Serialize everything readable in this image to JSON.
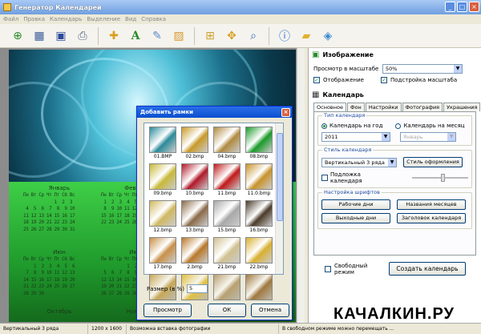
{
  "window": {
    "title": "Генератор Календарей"
  },
  "menu": [
    "Файл",
    "Правка",
    "Календарь",
    "Выделение",
    "Вид",
    "Справка"
  ],
  "toolbar": {
    "buttons": [
      "add-image",
      "calendar",
      "save",
      "print",
      "add-frame",
      "add-text",
      "edit",
      "picture",
      "grid",
      "move",
      "zoom",
      "help",
      "folder",
      "box"
    ]
  },
  "calendar_preview": {
    "months": [
      {
        "name": "Январь",
        "header": "Пн Вт Ср Чт Пт Сб Вс",
        "days": "            1  2  3\n 4  5  6  7  8  9 10\n11 12 13 14 15 16 17\n18 19 20 21 22 23 24\n25 26 27 28 29 30 31"
      },
      {
        "name": "Февраль",
        "header": "Пн Вт Ср Чт Пт Сб Вс",
        "days": " 1  2  3  4  5  6  7\n 8  9 10 11 12 13 14\n15 16 17 18 19 20 21\n22 23 24 25 26 27 28"
      },
      {
        "name": "Июн",
        "header": "Пн Вт Ср Чт Пт Сб Вс",
        "days": "    1  2  3  4  5  6\n 7  8  9 10 11 12 13\n14 15 16 17 18 19 20\n21 22 23 24 25 26 27\n28 29 30"
      },
      {
        "name": "Июль",
        "header": "Пн Вт Ср Чт Пт Сб Вс",
        "days": "          1  2  3  4\n 5  6  7  8  9 10 11\n12 13 14 15 16 17 18\n19 20 21 22 23 24 25\n26 27 28 29 30 31"
      },
      {
        "name": "Октябрь",
        "header": "",
        "days": ""
      },
      {
        "name": "Ноябрь",
        "header": "",
        "days": ""
      }
    ]
  },
  "image_panel": {
    "header": "Изображение",
    "zoom_label": "Просмотр в масштабе",
    "zoom_value": "50%",
    "stretch_label": "Отображение",
    "fit_label": "Подстройка масштаба"
  },
  "calendar_panel": {
    "header": "Календарь",
    "tabs": [
      "Основное",
      "Фон",
      "Настройки",
      "Фотография",
      "Украшения"
    ],
    "type_group": "Тип календаря",
    "radio_year": "Календарь на год",
    "radio_month": "Календарь на месяц",
    "year_value": "2011",
    "month_value": "Январь",
    "style_group": "Стиль календаря",
    "style_value": "Вертикальный 3 ряда",
    "style_button": "Стиль оформления",
    "shadow_label": "Подложка календаря",
    "fonts_group": "Настройка шрифтов",
    "btn_workdays": "Рабочие дни",
    "btn_monthnames": "Названия месяцев",
    "btn_weekends": "Выходные дни",
    "btn_title": "Заголовок календаря",
    "free_mode_label": "Свободный режим",
    "create_button": "Создать календарь"
  },
  "dialog": {
    "title": "Добавить рамки",
    "tiles": [
      {
        "label": "01.BMP",
        "color": "#2a8a9a"
      },
      {
        "label": "02.bmp",
        "color": "#c89a28"
      },
      {
        "label": "04.bmp",
        "color": "#b08a40"
      },
      {
        "label": "08.bmp",
        "color": "#1a9a2a"
      },
      {
        "label": "09.bmp",
        "color": "#c8b838"
      },
      {
        "label": "10.bmp",
        "color": "#b01828"
      },
      {
        "label": "11.bmp",
        "color": "#c01818"
      },
      {
        "label": "11.0.bmp",
        "color": "#c8922a"
      },
      {
        "label": "12.bmp",
        "color": "#d0b860"
      },
      {
        "label": "13.bmp",
        "color": "#8a6a48"
      },
      {
        "label": "15.bmp",
        "color": "#a8a8a8"
      },
      {
        "label": "16.bmp",
        "color": "#4a3a28"
      },
      {
        "label": "17.bmp",
        "color": "#c89048"
      },
      {
        "label": "2.bmp",
        "color": "#b8782a"
      },
      {
        "label": "21.bmp",
        "color": "#d0c090"
      },
      {
        "label": "22.bmp",
        "color": "#d8b030"
      },
      {
        "label": "",
        "color": "#c8a858"
      },
      {
        "label": "",
        "color": "#e0c040"
      },
      {
        "label": "",
        "color": "#b8a070"
      },
      {
        "label": "",
        "color": "#a07840"
      }
    ],
    "size_label": "Размер (в %)",
    "size_value": "5",
    "preview_button": "Просмотр",
    "ok_button": "ОК",
    "cancel_button": "Отмена"
  },
  "status": {
    "style": "Вертикальный 3 ряда",
    "resolution": "1200 x 1600",
    "mode": "Возможна вставка фотографии",
    "hint": "В свободном режиме можно перемещать ..."
  },
  "watermark": "КАЧАЛКИН.РУ"
}
